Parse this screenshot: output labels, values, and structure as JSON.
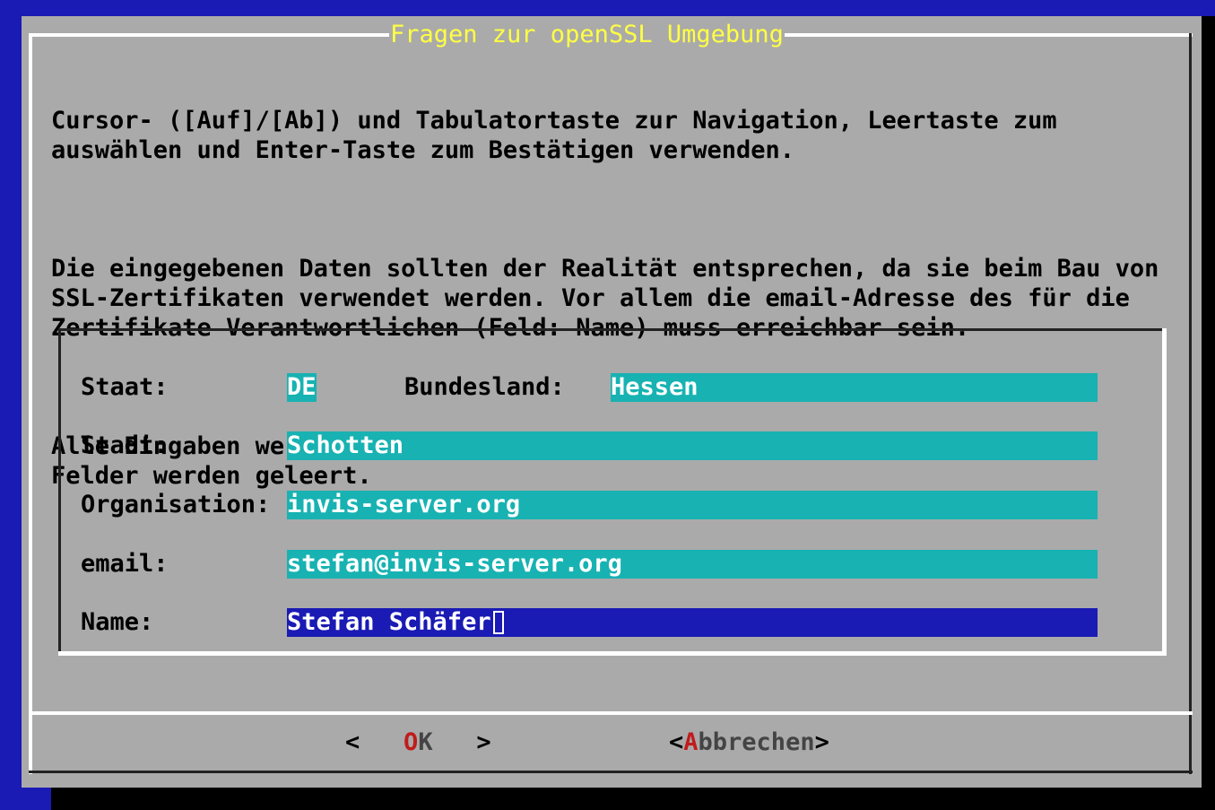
{
  "dialog": {
    "title": "Fragen zur openSSL Umgebung",
    "intro": [
      "Cursor- ([Auf]/[Ab]) und Tabulatortaste zur Navigation, Leertaste zum\nauswählen und Enter-Taste zum Bestätigen verwenden.",
      "Die eingegebenen Daten sollten der Realität entsprechen, da sie beim Bau von\nSSL-Zertifikaten verwendet werden. Vor allem die email-Adresse des für die\nZertifikate Verantwortlichen (Feld: Name) muss erreichbar sein.",
      "Alle Eingaben werden auf Plausibilität geprüft, fehlerhaft ausgefüllte\nFelder werden geleert."
    ]
  },
  "form": {
    "staat": {
      "label": "Staat:",
      "value": "DE"
    },
    "bundesland": {
      "label": "Bundesland:",
      "value": "Hessen"
    },
    "stadt": {
      "label": "Stadt:",
      "value": "Schotten"
    },
    "organisation": {
      "label": "Organisation:",
      "value": "invis-server.org"
    },
    "email": {
      "label": "email:",
      "value": "stefan@invis-server.org"
    },
    "name": {
      "label": "Name:",
      "value": "Stefan Schäfer"
    }
  },
  "buttons": {
    "ok": {
      "left": "<",
      "hotkey": "O",
      "rest": "K",
      "right": ">"
    },
    "cancel": {
      "left": "<",
      "hotkey": "A",
      "rest": "bbrechen",
      "right": ">"
    }
  },
  "colors": {
    "background": "#1a1ab4",
    "dialog": "#aaaaaa",
    "title": "#ffff44",
    "field": "#18b2b2",
    "active_field": "#1a1ab4",
    "hotkey": "#c01c1c"
  }
}
